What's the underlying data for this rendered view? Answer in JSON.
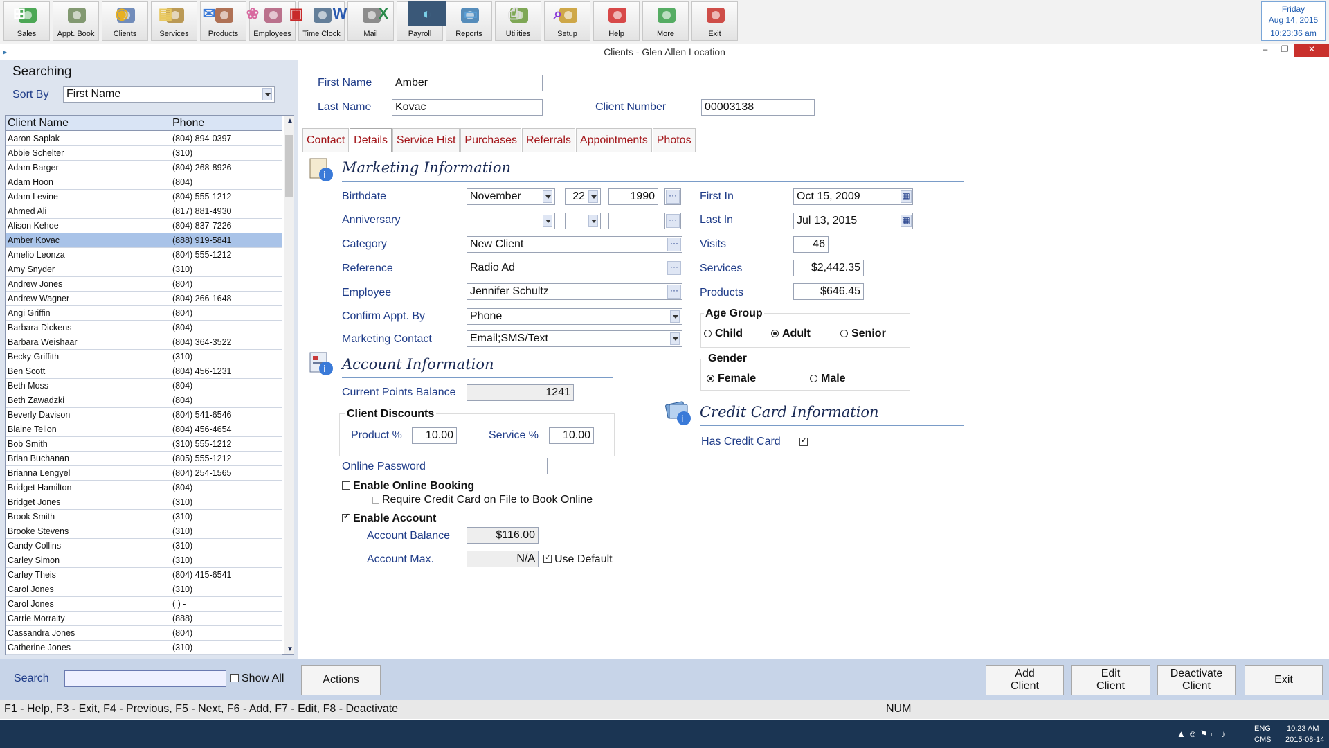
{
  "toolbar": {
    "buttons": [
      {
        "label": "Sales",
        "icon": "sales-icon",
        "color": "#2f9a3a"
      },
      {
        "label": "Appt. Book",
        "icon": "appt-book-icon",
        "color": "#6f8a5a"
      },
      {
        "label": "Clients",
        "icon": "clients-icon",
        "color": "#5a7ab0"
      },
      {
        "label": "Services",
        "icon": "services-icon",
        "color": "#b08a3a"
      },
      {
        "label": "Products",
        "icon": "products-icon",
        "color": "#a35a3a"
      },
      {
        "label": "Employees",
        "icon": "employees-icon",
        "color": "#b05a7a"
      },
      {
        "label": "Time Clock",
        "icon": "time-clock-icon",
        "color": "#4a6a8a"
      },
      {
        "label": "Mail",
        "icon": "mail-icon",
        "color": "#7a7a7a"
      },
      {
        "label": "Payroll",
        "icon": "payroll-icon",
        "color": "#8a6a3a"
      },
      {
        "label": "Reports",
        "icon": "reports-icon",
        "color": "#3a7ab0"
      },
      {
        "label": "Utilities",
        "icon": "utilities-icon",
        "color": "#6a9a3a"
      },
      {
        "label": "Setup",
        "icon": "setup-icon",
        "color": "#c89a2a"
      },
      {
        "label": "Help",
        "icon": "help-icon",
        "color": "#d22a2a"
      },
      {
        "label": "More",
        "icon": "more-icon",
        "color": "#3aa04a"
      },
      {
        "label": "Exit",
        "icon": "exit-icon",
        "color": "#c8302a"
      }
    ]
  },
  "clock": {
    "day": "Friday",
    "date": "Aug 14, 2015",
    "time": "10:23:36 am"
  },
  "window": {
    "title": "Clients - Glen Allen Location"
  },
  "search_panel": {
    "heading": "Searching",
    "sort_by_label": "Sort By",
    "sort_by_value": "First Name",
    "col_name": "Client Name",
    "col_phone": "Phone"
  },
  "clients": [
    {
      "name": "Aaron Saplak",
      "phone": "(804) 894-0397"
    },
    {
      "name": "Abbie Schelter",
      "phone": "(310)"
    },
    {
      "name": "Adam Barger",
      "phone": "(804) 268-8926"
    },
    {
      "name": "Adam Hoon",
      "phone": "(804)"
    },
    {
      "name": "Adam Levine",
      "phone": "(804) 555-1212"
    },
    {
      "name": "Ahmed Ali",
      "phone": "(817) 881-4930"
    },
    {
      "name": "Alison Kehoe",
      "phone": "(804) 837-7226"
    },
    {
      "name": "Amber Kovac",
      "phone": "(888) 919-5841"
    },
    {
      "name": "Amelio Leonza",
      "phone": "(804) 555-1212"
    },
    {
      "name": "Amy Snyder",
      "phone": "(310)"
    },
    {
      "name": "Andrew Jones",
      "phone": "(804)"
    },
    {
      "name": "Andrew Wagner",
      "phone": "(804) 266-1648"
    },
    {
      "name": "Angi Griffin",
      "phone": "(804)"
    },
    {
      "name": "Barbara Dickens",
      "phone": "(804)"
    },
    {
      "name": "Barbara Weishaar",
      "phone": "(804) 364-3522"
    },
    {
      "name": "Becky Griffith",
      "phone": "(310)"
    },
    {
      "name": "Ben Scott",
      "phone": "(804) 456-1231"
    },
    {
      "name": "Beth Moss",
      "phone": "(804)"
    },
    {
      "name": "Beth Zawadzki",
      "phone": "(804)"
    },
    {
      "name": "Beverly Davison",
      "phone": "(804) 541-6546"
    },
    {
      "name": "Blaine Tellon",
      "phone": "(804) 456-4654"
    },
    {
      "name": "Bob Smith",
      "phone": "(310) 555-1212"
    },
    {
      "name": "Brian Buchanan",
      "phone": "(805) 555-1212"
    },
    {
      "name": "Brianna Lengyel",
      "phone": "(804) 254-1565"
    },
    {
      "name": "Bridget Hamilton",
      "phone": "(804)"
    },
    {
      "name": "Bridget Jones",
      "phone": "(310)"
    },
    {
      "name": "Brook Smith",
      "phone": "(310)"
    },
    {
      "name": "Brooke Stevens",
      "phone": "(310)"
    },
    {
      "name": "Candy Collins",
      "phone": "(310)"
    },
    {
      "name": "Carley Simon",
      "phone": "(310)"
    },
    {
      "name": "Carley Theis",
      "phone": "(804) 415-6541"
    },
    {
      "name": "Carol Jones",
      "phone": "(310)"
    },
    {
      "name": "Carol Jones",
      "phone": "(   )    -"
    },
    {
      "name": "Carrie Morraity",
      "phone": "(888)"
    },
    {
      "name": "Cassandra Jones",
      "phone": "(804)"
    },
    {
      "name": "Catherine Jones",
      "phone": "(310)"
    }
  ],
  "selected_client": "Amber Kovac",
  "header": {
    "first_name_label": "First Name",
    "first_name": "Amber",
    "last_name_label": "Last Name",
    "last_name": "Kovac",
    "client_number_label": "Client Number",
    "client_number": "00003138"
  },
  "tabs": [
    "Contact",
    "Details",
    "Service Hist",
    "Purchases",
    "Referrals",
    "Appointments",
    "Photos"
  ],
  "active_tab": "Details",
  "marketing": {
    "title": "Marketing Information",
    "birthdate_label": "Birthdate",
    "birth_month": "November",
    "birth_day": "22",
    "birth_year": "1990",
    "anniversary_label": "Anniversary",
    "category_label": "Category",
    "category": "New Client",
    "reference_label": "Reference",
    "reference": "Radio Ad",
    "employee_label": "Employee",
    "employee": "Jennifer Schultz",
    "confirm_label": "Confirm Appt. By",
    "confirm": "Phone",
    "contact_label": "Marketing Contact",
    "contact": "Email;SMS/Text"
  },
  "stats": {
    "first_in_label": "First In",
    "first_in": "Oct 15, 2009",
    "last_in_label": "Last In",
    "last_in": "Jul 13, 2015",
    "visits_label": "Visits",
    "visits": "46",
    "services_label": "Services",
    "services": "$2,442.35",
    "products_label": "Products",
    "products": "$646.45"
  },
  "age_group": {
    "label": "Age Group",
    "options": [
      "Child",
      "Adult",
      "Senior"
    ],
    "selected": "Adult"
  },
  "gender": {
    "label": "Gender",
    "options": [
      "Female",
      "Male"
    ],
    "selected": "Female"
  },
  "account": {
    "title": "Account Information",
    "points_label": "Current Points Balance",
    "points": "1241",
    "discounts_label": "Client Discounts",
    "product_label": "Product %",
    "product": "10.00",
    "service_label": "Service %",
    "service": "10.00",
    "password_label": "Online Password",
    "password": "",
    "online_booking_label": "Enable Online Booking",
    "online_booking": false,
    "require_cc_label": "Require Credit Card on File to Book Online",
    "require_cc": false,
    "enable_account_label": "Enable Account",
    "enable_account": true,
    "balance_label": "Account Balance",
    "balance": "$116.00",
    "max_label": "Account Max.",
    "max": "N/A",
    "use_default_label": "Use Default",
    "use_default": true
  },
  "credit_card": {
    "title": "Credit Card Information",
    "has_label": "Has Credit Card",
    "has": true
  },
  "bottom": {
    "search_label": "Search",
    "search_value": "",
    "show_all_label": "Show All",
    "actions_label": "Actions",
    "add_label": "Add\nClient",
    "edit_label": "Edit\nClient",
    "deactivate_label": "Deactivate\nClient",
    "exit_label": "Exit"
  },
  "status": {
    "hint": "F1 - Help, F3 - Exit, F4 - Previous, F5 - Next, F6 - Add, F7 - Edit, F8 - Deactivate",
    "num": "NUM"
  },
  "taskbar": {
    "apps": [
      "windows-start-icon",
      "chrome-icon",
      "file-explorer-icon",
      "outlook-icon",
      "paint-icon",
      "acrobat-icon",
      "word-icon",
      "excel-icon",
      "salon-app-icon",
      "photo-viewer-icon",
      "printer-icon",
      "search-app-icon"
    ],
    "lang1": "ENG",
    "lang2": "CMS",
    "time": "10:23 AM",
    "date": "2015-08-14"
  },
  "colors": {
    "accent": "#1f3c88",
    "tab_text": "#a3161a",
    "selection": "#a9c3e8",
    "bottom_bar": "#c7d4e8"
  }
}
